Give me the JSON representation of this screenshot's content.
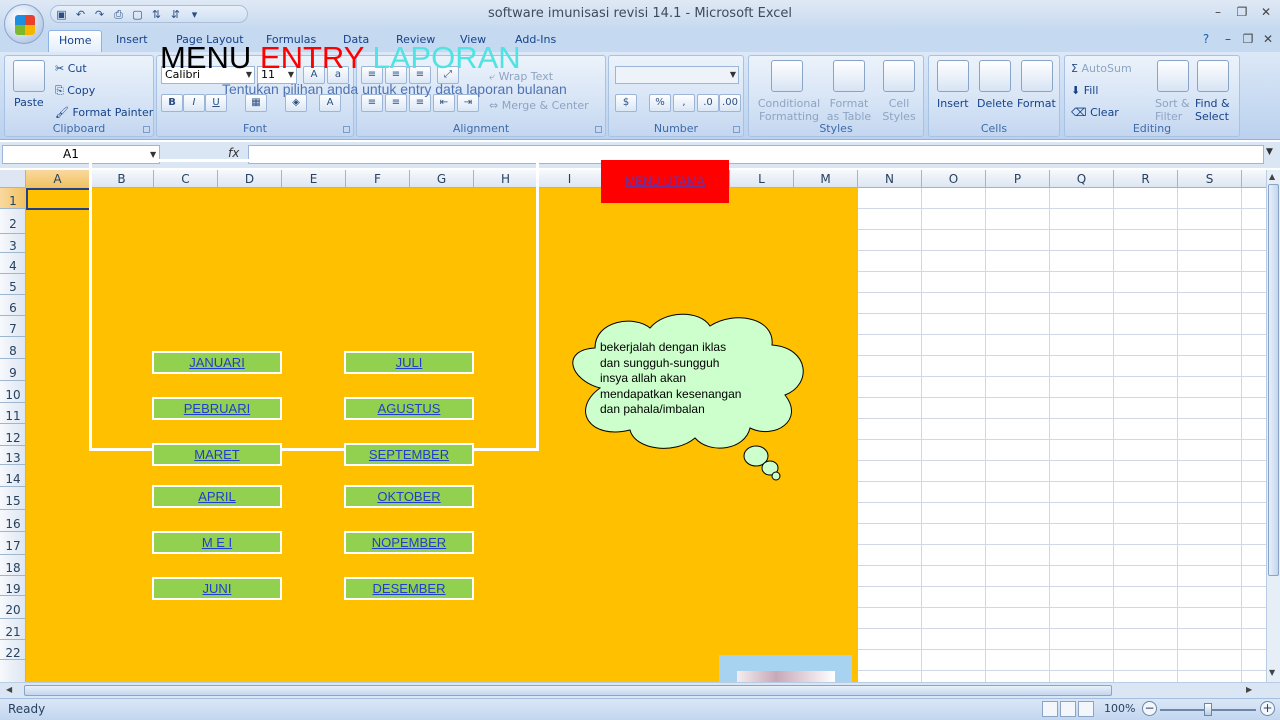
{
  "window": {
    "title": "software imunisasi revisi 14.1  -  Microsoft Excel"
  },
  "qat": {
    "icons": [
      "save-icon",
      "undo-icon",
      "redo-icon",
      "print-preview-icon",
      "new-icon",
      "sort-asc-icon",
      "sort-desc-icon",
      "customize-icon"
    ]
  },
  "tabs": [
    "Home",
    "Insert",
    "Page Layout",
    "Formulas",
    "Data",
    "Review",
    "View",
    "Add-Ins"
  ],
  "active_tab": "Home",
  "ribbon": {
    "clipboard": {
      "label": "Clipboard",
      "paste": "Paste",
      "cut": "Cut",
      "copy": "Copy",
      "format_painter": "Format Painter"
    },
    "font": {
      "label": "Font",
      "font_name": "Calibri",
      "font_size": "11",
      "bold": "B",
      "italic": "I",
      "underline": "U"
    },
    "alignment": {
      "label": "Alignment",
      "wrap_text": "Wrap Text",
      "merge_center": "Merge & Center"
    },
    "number": {
      "label": "Number",
      "format": "",
      "percent": "%",
      "comma": ","
    },
    "styles": {
      "label": "Styles",
      "conditional": "Conditional",
      "conditional2": "Formatting",
      "format_table": "Format",
      "format_table2": "as Table",
      "cell_styles": "Cell",
      "cell_styles2": "Styles"
    },
    "cells": {
      "label": "Cells",
      "insert": "Insert",
      "delete": "Delete",
      "format": "Format"
    },
    "editing": {
      "label": "Editing",
      "autosum": "AutoSum",
      "fill": "Fill",
      "clear": "Clear",
      "sort": "Sort &",
      "sort2": "Filter",
      "find": "Find &",
      "find2": "Select"
    }
  },
  "formula_bar": {
    "name_box": "A1",
    "fx": "fx",
    "value": ""
  },
  "columns": [
    "A",
    "B",
    "C",
    "D",
    "E",
    "F",
    "G",
    "H",
    "I",
    "J",
    "K",
    "L",
    "M",
    "N",
    "O",
    "P",
    "Q",
    "R",
    "S"
  ],
  "rows": [
    "1",
    "2",
    "3",
    "4",
    "5",
    "6",
    "7",
    "8",
    "9",
    "10",
    "11",
    "12",
    "13",
    "14",
    "15",
    "16",
    "17",
    "18",
    "19",
    "20",
    "21",
    "22"
  ],
  "sheet": {
    "title_word1": "MENU",
    "title_word2": "ENTRY",
    "title_word3": "LAPORAN",
    "subtitle": "Tentukan pilihan anda untuk entry data laporan bulanan",
    "months_left": [
      "JANUARI",
      "PEBRUARI",
      "MARET",
      "APRIL",
      "M E I",
      "JUNI"
    ],
    "months_right": [
      "JULI",
      "AGUSTUS",
      "SEPTEMBER",
      "OKTOBER",
      "NOPEMBER",
      "DESEMBER"
    ],
    "menu_utama": "MENU UTAMA",
    "cloud_lines": [
      "bekerjalah dengan iklas",
      "dan sungguh-sungguh",
      "insya allah akan",
      "mendapatkan kesenangan",
      "dan pahala/imbalan"
    ],
    "colors": {
      "background": "#ffc000",
      "button": "#92d050",
      "menu_utama": "#ff0000",
      "cloud": "#ccffcc"
    }
  },
  "status": {
    "text": "Ready",
    "zoom": "100%"
  }
}
